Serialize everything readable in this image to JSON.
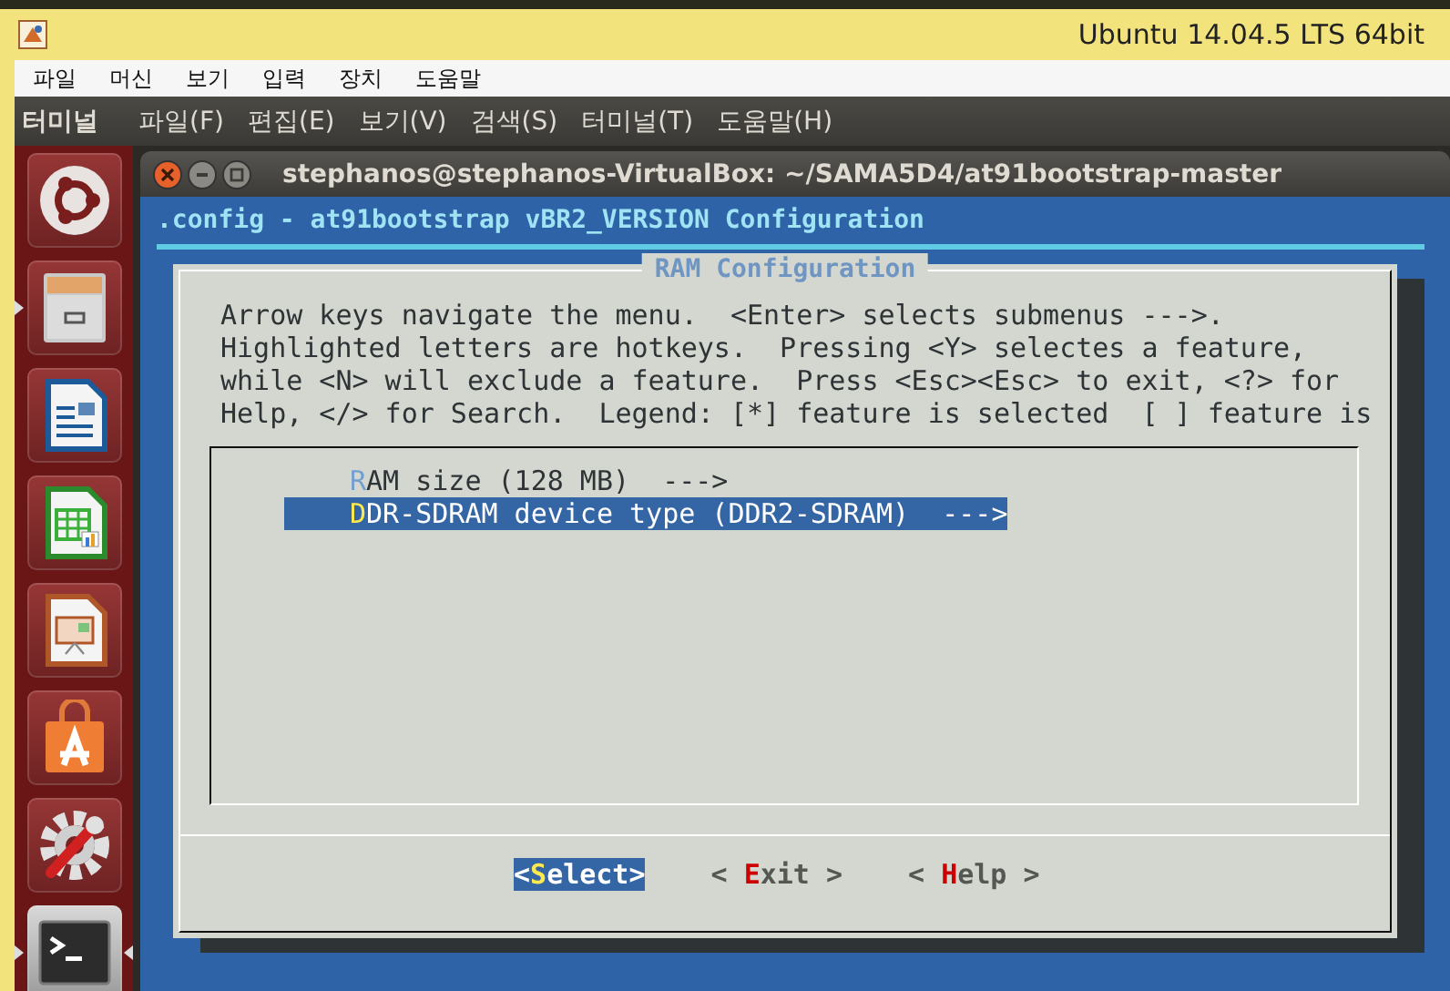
{
  "window": {
    "title": "Ubuntu 14.04.5 LTS 64bit"
  },
  "vm_menu": [
    "파일",
    "머신",
    "보기",
    "입력",
    "장치",
    "도움말"
  ],
  "panel": {
    "app": "터미널",
    "menus": [
      "파일(F)",
      "편집(E)",
      "보기(V)",
      "검색(S)",
      "터미널(T)",
      "도움말(H)"
    ]
  },
  "launcher": [
    {
      "kind": "ubuntu",
      "running": false,
      "focused": false
    },
    {
      "kind": "files",
      "running": true,
      "focused": false
    },
    {
      "kind": "writer",
      "running": false,
      "focused": false
    },
    {
      "kind": "calc",
      "running": false,
      "focused": false
    },
    {
      "kind": "impress",
      "running": false,
      "focused": false
    },
    {
      "kind": "software",
      "running": false,
      "focused": false
    },
    {
      "kind": "settings",
      "running": false,
      "focused": false
    },
    {
      "kind": "terminal",
      "running": true,
      "focused": true
    }
  ],
  "terminal": {
    "title": "stephanos@stephanos-VirtualBox: ~/SAMA5D4/at91bootstrap-master",
    "header": ".config - at91bootstrap vBR2_VERSION Configuration",
    "dialog": {
      "title": "RAM Configuration",
      "help_lines": [
        "Arrow keys navigate the menu.  <Enter> selects submenus --->.",
        "Highlighted letters are hotkeys.  Pressing <Y> selectes a feature,",
        "while <N> will exclude a feature.  Press <Esc><Esc> to exit, <?> for",
        "Help, </> for Search.  Legend: [*] feature is selected  [ ] feature is"
      ],
      "items": [
        {
          "hotkey": "R",
          "rest": "AM size (128 MB)  --->",
          "selected": false
        },
        {
          "hotkey": "D",
          "rest": "DR-SDRAM device type (DDR2-SDRAM)  --->",
          "selected": true
        }
      ],
      "buttons": [
        {
          "before": "<",
          "hotkey": "S",
          "after": "elect>",
          "selected": true
        },
        {
          "before": "< ",
          "hotkey": "E",
          "after": "xit >",
          "selected": false
        },
        {
          "before": "< ",
          "hotkey": "H",
          "after": "elp >",
          "selected": false
        }
      ]
    }
  }
}
